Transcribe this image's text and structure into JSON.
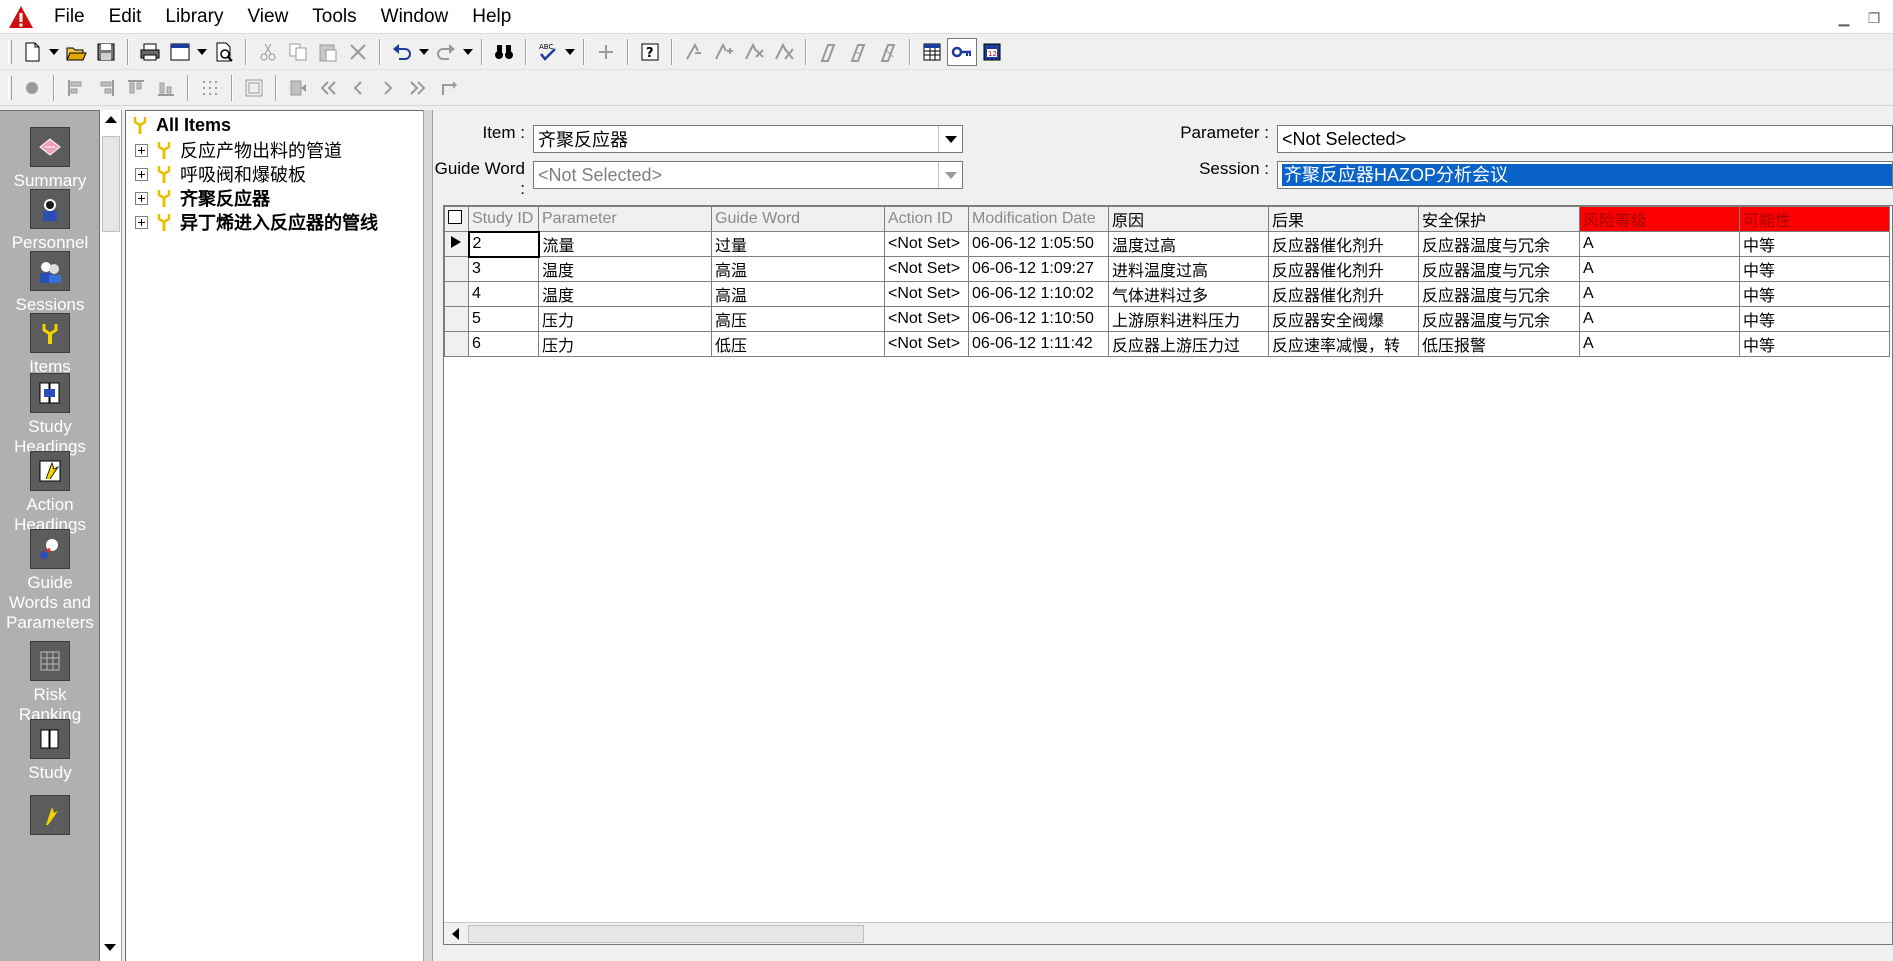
{
  "menu": [
    "File",
    "Edit",
    "Library",
    "View",
    "Tools",
    "Window",
    "Help"
  ],
  "toolbar1_icons": [
    "new-document-icon",
    "open-folder-icon",
    "save-icon",
    "print-icon",
    "page-setup-icon",
    "print-preview-icon",
    "cut-icon",
    "copy-icon",
    "paste-icon",
    "delete-icon",
    "undo-icon",
    "redo-icon",
    "find-binoculars-icon",
    "spellcheck-icon",
    "add-icon",
    "help-icon",
    "link-action-icon",
    "link-multi-icon",
    "unlink-icon",
    "unlink-all-icon",
    "filter-icon",
    "filter-edit-icon",
    "filter-clear-icon",
    "grid-view-icon",
    "key-icon",
    "calendar-icon"
  ],
  "nav": [
    {
      "id": "summary",
      "label": [
        "Summary"
      ]
    },
    {
      "id": "personnel",
      "label": [
        "Personnel"
      ]
    },
    {
      "id": "sessions",
      "label": [
        "Sessions"
      ]
    },
    {
      "id": "items",
      "label": [
        "Items"
      ]
    },
    {
      "id": "study-headings",
      "label": [
        "Study",
        "Headings"
      ]
    },
    {
      "id": "action-headings",
      "label": [
        "Action",
        "Headings"
      ]
    },
    {
      "id": "guide-words",
      "label": [
        "Guide",
        "Words and",
        "Parameters"
      ]
    },
    {
      "id": "risk-ranking",
      "label": [
        "Risk",
        "Ranking"
      ]
    },
    {
      "id": "study",
      "label": [
        "Study"
      ]
    }
  ],
  "tree": {
    "root": "All Items",
    "items": [
      {
        "label": "反应产物出料的管道",
        "bold": false
      },
      {
        "label": "呼吸阀和爆破板",
        "bold": false
      },
      {
        "label": "齐聚反应器",
        "bold": true
      },
      {
        "label": "异丁烯进入反应器的管线",
        "bold": true
      }
    ]
  },
  "filters": {
    "item_label": "Item :",
    "item_value": "齐聚反应器",
    "guide_label": "Guide Word :",
    "guide_value": "<Not Selected>",
    "param_label": "Parameter :",
    "param_value": "<Not Selected>",
    "session_label": "Session :",
    "session_value": "齐聚反应器HAZOP分析会议"
  },
  "table": {
    "columns": [
      {
        "label": "Study ID",
        "style": "dim",
        "w": 70
      },
      {
        "label": "Parameter",
        "style": "dim",
        "w": 173
      },
      {
        "label": "Guide Word",
        "style": "dim",
        "w": 173
      },
      {
        "label": "Action ID",
        "style": "dim",
        "w": 84
      },
      {
        "label": "Modification Date",
        "style": "dim",
        "w": 140
      },
      {
        "label": "原因",
        "style": "",
        "w": 160
      },
      {
        "label": "后果",
        "style": "",
        "w": 150
      },
      {
        "label": "安全保护",
        "style": "",
        "w": 161
      },
      {
        "label": "风险等级",
        "style": "red",
        "w": 160
      },
      {
        "label": "可能性",
        "style": "red",
        "w": 150
      }
    ],
    "rows": [
      [
        "2",
        "流量",
        "过量",
        "<Not Set>",
        "06-06-12 1:05:50",
        "温度过高",
        "反应器催化剂升",
        "反应器温度与冗余",
        "A",
        "中等"
      ],
      [
        "3",
        "温度",
        "高温",
        "<Not Set>",
        "06-06-12 1:09:27",
        "进料温度过高",
        "反应器催化剂升",
        "反应器温度与冗余",
        "A",
        "中等"
      ],
      [
        "4",
        "温度",
        "高温",
        "<Not Set>",
        "06-06-12 1:10:02",
        "气体进料过多",
        "反应器催化剂升",
        "反应器温度与冗余",
        "A",
        "中等"
      ],
      [
        "5",
        "压力",
        "高压",
        "<Not Set>",
        "06-06-12 1:10:50",
        "上游原料进料压力",
        "反应器安全阀爆",
        "反应器温度与冗余",
        "A",
        "中等"
      ],
      [
        "6",
        "压力",
        "低压",
        "<Not Set>",
        "06-06-12 1:11:42",
        "反应器上游压力过",
        "反应速率减慢，转",
        "低压报警",
        "A",
        "中等"
      ]
    ]
  },
  "colors": {
    "accent": "#0a63c9",
    "risk_header": "#ff0000",
    "nav_bg": "#b0b0b0"
  }
}
